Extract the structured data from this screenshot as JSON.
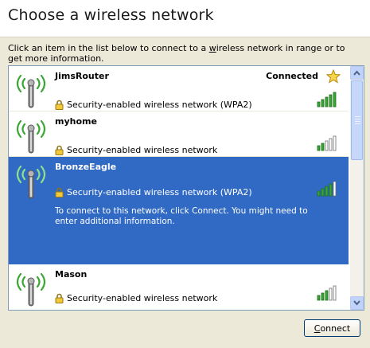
{
  "title": "Choose a wireless network",
  "description": {
    "before": "Click an item in the list below to connect to a ",
    "underlined": "w",
    "after": "ireless network in range or to get more information."
  },
  "networks": [
    {
      "name": "JimsRouter",
      "status": "Connected",
      "security": "Security-enabled wireless network (WPA2)",
      "signal_bars": 5,
      "selected": false,
      "info": ""
    },
    {
      "name": "myhome",
      "status": "",
      "security": "Security-enabled wireless network",
      "signal_bars": 2,
      "selected": false,
      "info": ""
    },
    {
      "name": "BronzeEagle",
      "status": "",
      "security": "Security-enabled wireless network (WPA2)",
      "signal_bars": 4,
      "selected": true,
      "info": "To connect to this network, click Connect. You might need to enter additional information."
    },
    {
      "name": "Mason",
      "status": "",
      "security": "Security-enabled wireless network",
      "signal_bars": 3,
      "selected": false,
      "info": ""
    }
  ],
  "connect_button": {
    "key": "C",
    "rest": "onnect"
  },
  "colors": {
    "selection": "#316ac5",
    "signal_on": "#3aa635",
    "signal_off": "#ffffff",
    "accent_border": "#003c74"
  },
  "icons": {
    "network": "antenna-icon",
    "connected": "star-icon",
    "security": "lock-icon",
    "signal": "signal-strength-icon"
  }
}
